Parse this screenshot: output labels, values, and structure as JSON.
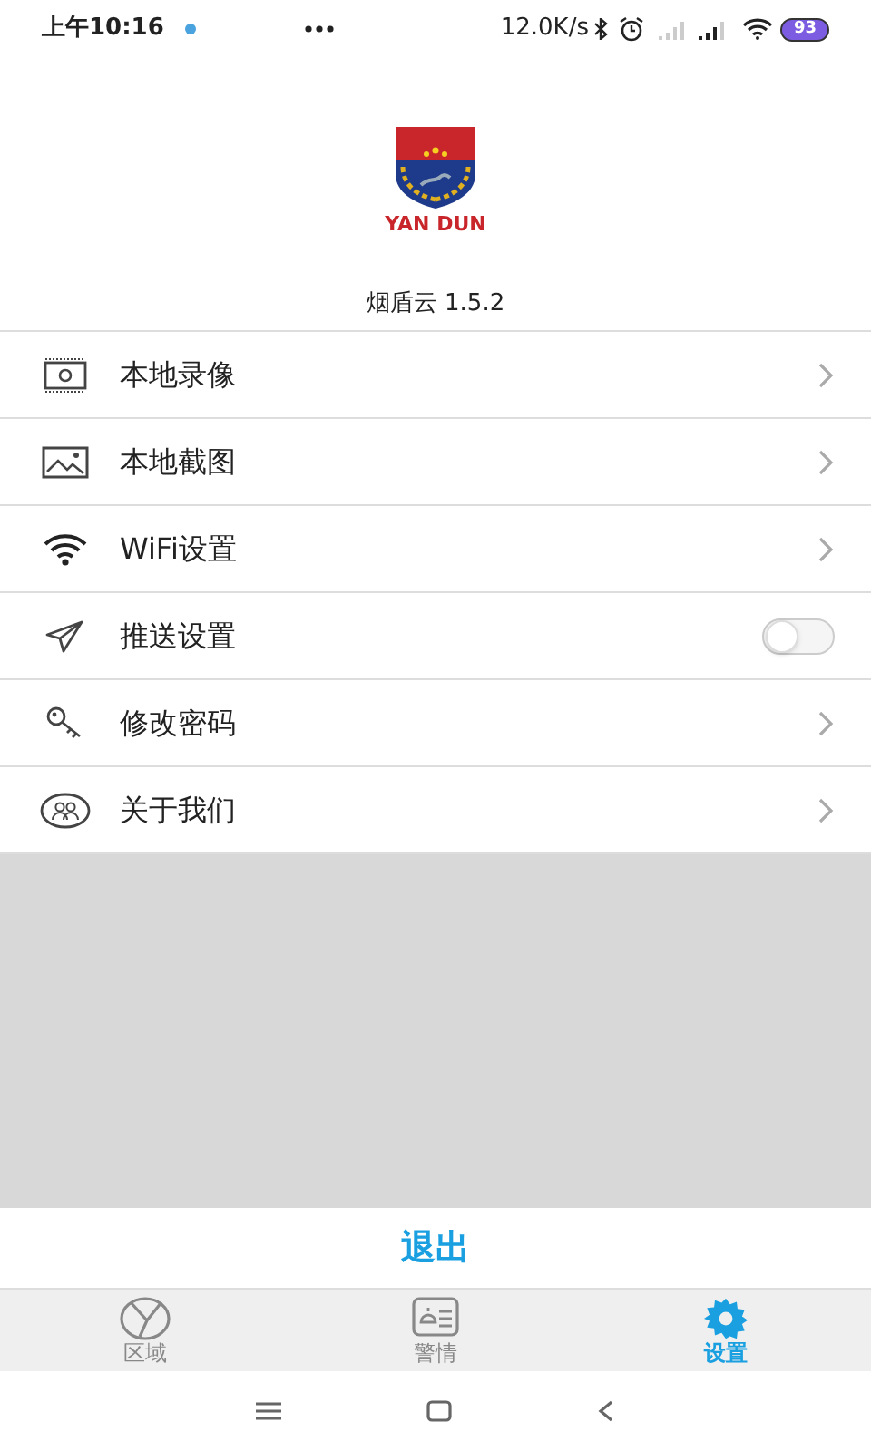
{
  "status_bar": {
    "time": "上午10:16",
    "speed": "12.0K/s",
    "battery": "93"
  },
  "header": {
    "logo_text": "YAN DUN",
    "app_title": "烟盾云 1.5.2"
  },
  "menu": [
    {
      "kind": "link",
      "label": "本地录像"
    },
    {
      "kind": "link",
      "label": "本地截图"
    },
    {
      "kind": "link",
      "label": "WiFi设置"
    },
    {
      "kind": "toggle",
      "label": "推送设置",
      "on": false
    },
    {
      "kind": "link",
      "label": "修改密码"
    },
    {
      "kind": "link",
      "label": "关于我们"
    }
  ],
  "logout_button": "退出",
  "tabs": [
    {
      "label": "区域",
      "selected": false
    },
    {
      "label": "警情",
      "selected": false
    },
    {
      "label": "设置",
      "selected": true
    }
  ]
}
